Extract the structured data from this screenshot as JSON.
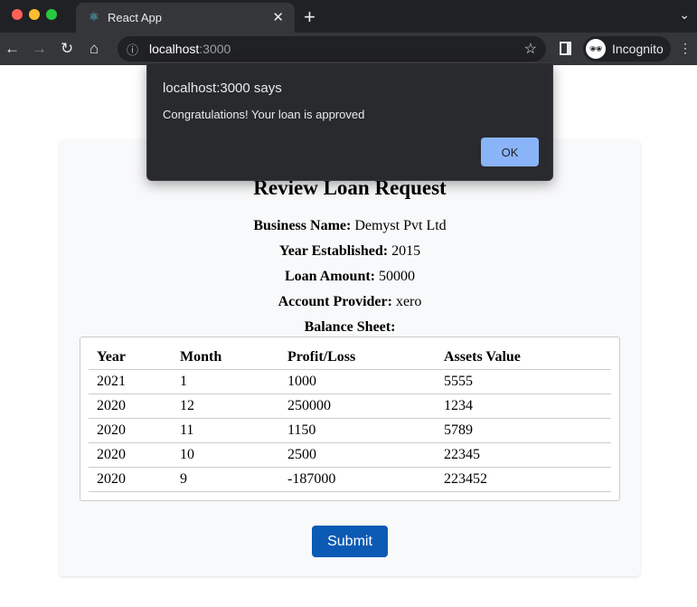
{
  "browser": {
    "tab_title": "React App",
    "url_host": "localhost",
    "url_port": ":3000",
    "profile": "Incognito"
  },
  "dialog": {
    "title": "localhost:3000 says",
    "message": "Congratulations! Your loan is approved",
    "ok_label": "OK"
  },
  "review": {
    "title": "Review Loan Request",
    "fields": [
      {
        "label": "Business Name:",
        "value": "Demyst Pvt Ltd"
      },
      {
        "label": "Year Established:",
        "value": "2015"
      },
      {
        "label": "Loan Amount:",
        "value": "50000"
      },
      {
        "label": "Account Provider:",
        "value": "xero"
      }
    ],
    "balance_label": "Balance Sheet:",
    "columns": [
      "Year",
      "Month",
      "Profit/Loss",
      "Assets Value"
    ],
    "rows": [
      [
        "2021",
        "1",
        "1000",
        "5555"
      ],
      [
        "2020",
        "12",
        "250000",
        "1234"
      ],
      [
        "2020",
        "11",
        "1150",
        "5789"
      ],
      [
        "2020",
        "10",
        "2500",
        "22345"
      ],
      [
        "2020",
        "9",
        "-187000",
        "223452"
      ]
    ],
    "submit_label": "Submit"
  },
  "colors": {
    "submit": "#0b5ab4",
    "ok_button": "#8ab4f8",
    "card_bg": "#f8f9fa"
  }
}
